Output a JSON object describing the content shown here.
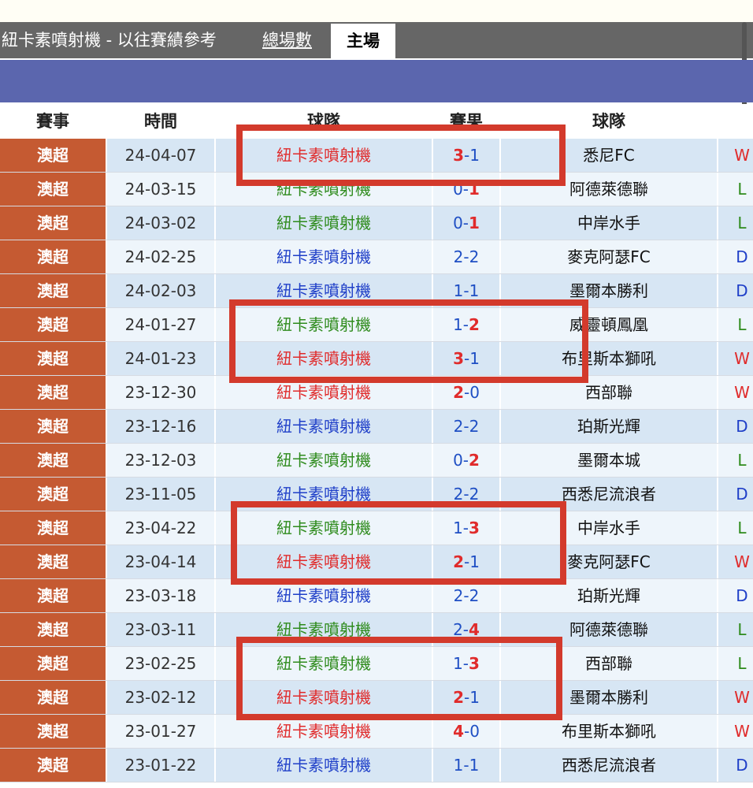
{
  "header": {
    "title": "紐卡素噴射機 - 以往賽績參考",
    "tabs": [
      {
        "label": "總場數",
        "active": false
      },
      {
        "label": "主場",
        "active": true
      }
    ]
  },
  "columns": [
    "賽事",
    "時間",
    "球隊",
    "賽果",
    "球隊"
  ],
  "colors": {
    "competition_bg": "#c55a32",
    "band": "#5b66ae",
    "tab_bar": "#666666",
    "win": "#e02b2b",
    "draw": "#1f3fc8",
    "loss": "#2e8b1c",
    "highlight_box": "#d33a2c"
  },
  "matches": [
    {
      "comp": "澳超",
      "date": "24-04-07",
      "home": "紐卡素噴射機",
      "s1": "3",
      "dash": "-",
      "s2": "1",
      "hl": 1,
      "away": "悉尼FC",
      "res": "W"
    },
    {
      "comp": "澳超",
      "date": "24-03-15",
      "home": "紐卡素噴射機",
      "s1": "0",
      "dash": "-",
      "s2": "1",
      "hl": 2,
      "away": "阿德萊德聯",
      "res": "L"
    },
    {
      "comp": "澳超",
      "date": "24-03-02",
      "home": "紐卡素噴射機",
      "s1": "0",
      "dash": "-",
      "s2": "1",
      "hl": 2,
      "away": "中岸水手",
      "res": "L"
    },
    {
      "comp": "澳超",
      "date": "24-02-25",
      "home": "紐卡素噴射機",
      "s1": "2",
      "dash": "-",
      "s2": "2",
      "hl": 0,
      "away": "麥克阿瑟FC",
      "res": "D"
    },
    {
      "comp": "澳超",
      "date": "24-02-03",
      "home": "紐卡素噴射機",
      "s1": "1",
      "dash": "-",
      "s2": "1",
      "hl": 0,
      "away": "墨爾本勝利",
      "res": "D"
    },
    {
      "comp": "澳超",
      "date": "24-01-27",
      "home": "紐卡素噴射機",
      "s1": "1",
      "dash": "-",
      "s2": "2",
      "hl": 2,
      "away": "威靈頓鳳凰",
      "res": "L"
    },
    {
      "comp": "澳超",
      "date": "24-01-23",
      "home": "紐卡素噴射機",
      "s1": "3",
      "dash": "-",
      "s2": "1",
      "hl": 1,
      "away": "布里斯本獅吼",
      "res": "W"
    },
    {
      "comp": "澳超",
      "date": "23-12-30",
      "home": "紐卡素噴射機",
      "s1": "2",
      "dash": "-",
      "s2": "0",
      "hl": 1,
      "away": "西部聯",
      "res": "W"
    },
    {
      "comp": "澳超",
      "date": "23-12-16",
      "home": "紐卡素噴射機",
      "s1": "2",
      "dash": "-",
      "s2": "2",
      "hl": 0,
      "away": "珀斯光輝",
      "res": "D"
    },
    {
      "comp": "澳超",
      "date": "23-12-03",
      "home": "紐卡素噴射機",
      "s1": "0",
      "dash": "-",
      "s2": "2",
      "hl": 2,
      "away": "墨爾本城",
      "res": "L"
    },
    {
      "comp": "澳超",
      "date": "23-11-05",
      "home": "紐卡素噴射機",
      "s1": "2",
      "dash": "-",
      "s2": "2",
      "hl": 0,
      "away": "西悉尼流浪者",
      "res": "D"
    },
    {
      "comp": "澳超",
      "date": "23-04-22",
      "home": "紐卡素噴射機",
      "s1": "1",
      "dash": "-",
      "s2": "3",
      "hl": 2,
      "away": "中岸水手",
      "res": "L"
    },
    {
      "comp": "澳超",
      "date": "23-04-14",
      "home": "紐卡素噴射機",
      "s1": "2",
      "dash": "-",
      "s2": "1",
      "hl": 1,
      "away": "麥克阿瑟FC",
      "res": "W"
    },
    {
      "comp": "澳超",
      "date": "23-03-18",
      "home": "紐卡素噴射機",
      "s1": "2",
      "dash": "-",
      "s2": "2",
      "hl": 0,
      "away": "珀斯光輝",
      "res": "D"
    },
    {
      "comp": "澳超",
      "date": "23-03-11",
      "home": "紐卡素噴射機",
      "s1": "2",
      "dash": "-",
      "s2": "4",
      "hl": 2,
      "away": "阿德萊德聯",
      "res": "L"
    },
    {
      "comp": "澳超",
      "date": "23-02-25",
      "home": "紐卡素噴射機",
      "s1": "1",
      "dash": "-",
      "s2": "3",
      "hl": 2,
      "away": "西部聯",
      "res": "L"
    },
    {
      "comp": "澳超",
      "date": "23-02-12",
      "home": "紐卡素噴射機",
      "s1": "2",
      "dash": "-",
      "s2": "1",
      "hl": 1,
      "away": "墨爾本勝利",
      "res": "W"
    },
    {
      "comp": "澳超",
      "date": "23-01-27",
      "home": "紐卡素噴射機",
      "s1": "4",
      "dash": "-",
      "s2": "0",
      "hl": 1,
      "away": "布里斯本獅吼",
      "res": "W"
    },
    {
      "comp": "澳超",
      "date": "23-01-22",
      "home": "紐卡素噴射機",
      "s1": "1",
      "dash": "-",
      "s2": "1",
      "hl": 0,
      "away": "西悉尼流浪者",
      "res": "D"
    }
  ]
}
